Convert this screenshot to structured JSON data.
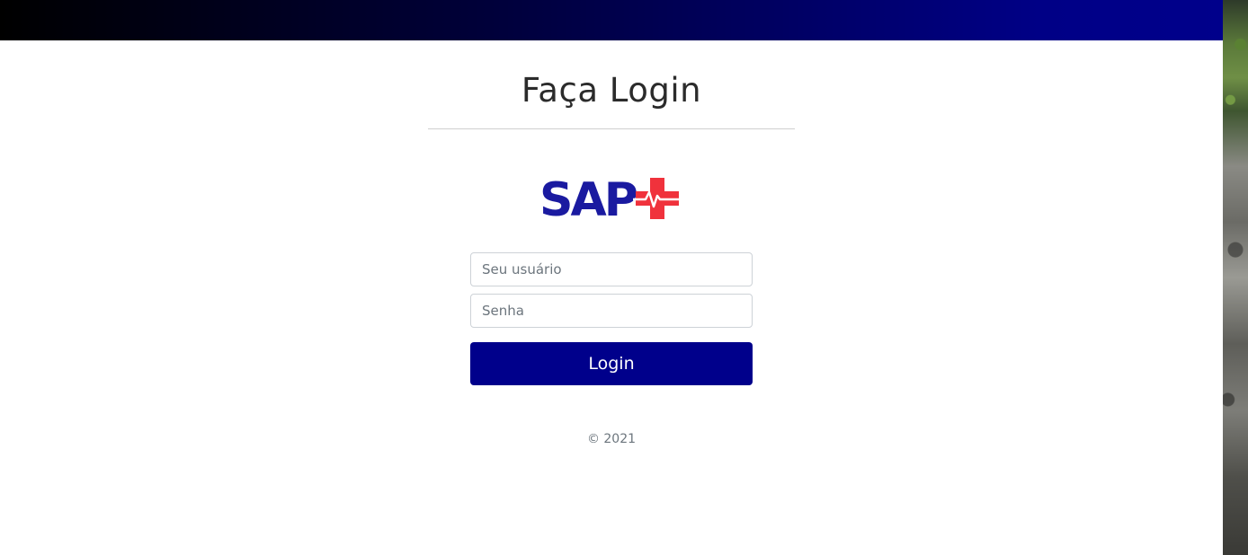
{
  "header": {
    "gradient_start": "#000000",
    "gradient_end": "#00008b"
  },
  "login": {
    "title": "Faça Login",
    "logo": {
      "text": "SAP",
      "text_color": "#1a1aa0",
      "cross_color": "#f0323c"
    },
    "username_placeholder": "Seu usuário",
    "password_placeholder": "Senha",
    "button_label": "Login",
    "button_color": "#00008b"
  },
  "footer": {
    "copyright": "© 2021"
  }
}
